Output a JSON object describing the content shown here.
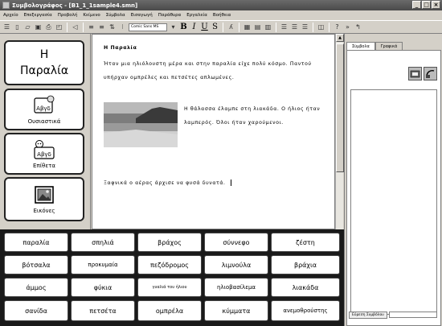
{
  "window": {
    "title": "Συμβολογράφος - [Β1_1_1sample4.smn]",
    "controls": [
      "_",
      "□",
      "×"
    ]
  },
  "menu": [
    "Αρχείο",
    "Επεξεργασία",
    "Προβολή",
    "Κείμενο",
    "Σύμβολα",
    "Εισαγωγή",
    "Παράθυρα",
    "Εργαλεία",
    "Βοήθεια"
  ],
  "toolbar": {
    "font_name": "Comic Sans MS",
    "bold": "B",
    "italic": "I",
    "underline": "U",
    "strike": "S"
  },
  "categories": {
    "main": {
      "title_line1": "Η",
      "title_line2": "Παραλία"
    },
    "nouns": {
      "symbol_text": "Αβγδ",
      "label": "Ουσιαστικά"
    },
    "adjectives": {
      "symbol_text": "Αβγδ",
      "label": "Επίθετα"
    },
    "pictures": {
      "label": "Εικόνες"
    }
  },
  "document": {
    "title": "Η Παραλία",
    "para1": "Ήταν μια ηλιόλουστη μέρα και στην παραλία είχε πολύ κόσμο. Παντού υπήρχαν ομπρέλες και πετσέτες απλωμένες.",
    "para2": "Η θάλασσα έλαμπε στη λιακάδα. Ο ήλιος ήταν λαμπερός. Όλοι ήταν χαρούμενοι.",
    "para3": "Ξαφνικά ο αέρας άρχισε να φυσά δυνατά."
  },
  "right_panel": {
    "tabs": [
      "Σύμβολα",
      "Γραφικά"
    ],
    "search_button": "Εύρεση Συμβόλου"
  },
  "word_grid": [
    [
      "παραλία",
      "σπηλιά",
      "βράχος",
      "σύννεφο",
      "ζέστη"
    ],
    [
      "βότσαλα",
      "προκυμαία",
      "πεζόδρομος",
      "λιμνούλα",
      "βράχια"
    ],
    [
      "άμμος",
      "φύκια",
      "γυαλιά του ήλιου",
      "ηλιοβασίλεμα",
      "λιακάδα"
    ],
    [
      "σανίδα",
      "πετσέτα",
      "ομπρέλα",
      "κύμματα",
      "ανεμοθρούστης"
    ]
  ]
}
